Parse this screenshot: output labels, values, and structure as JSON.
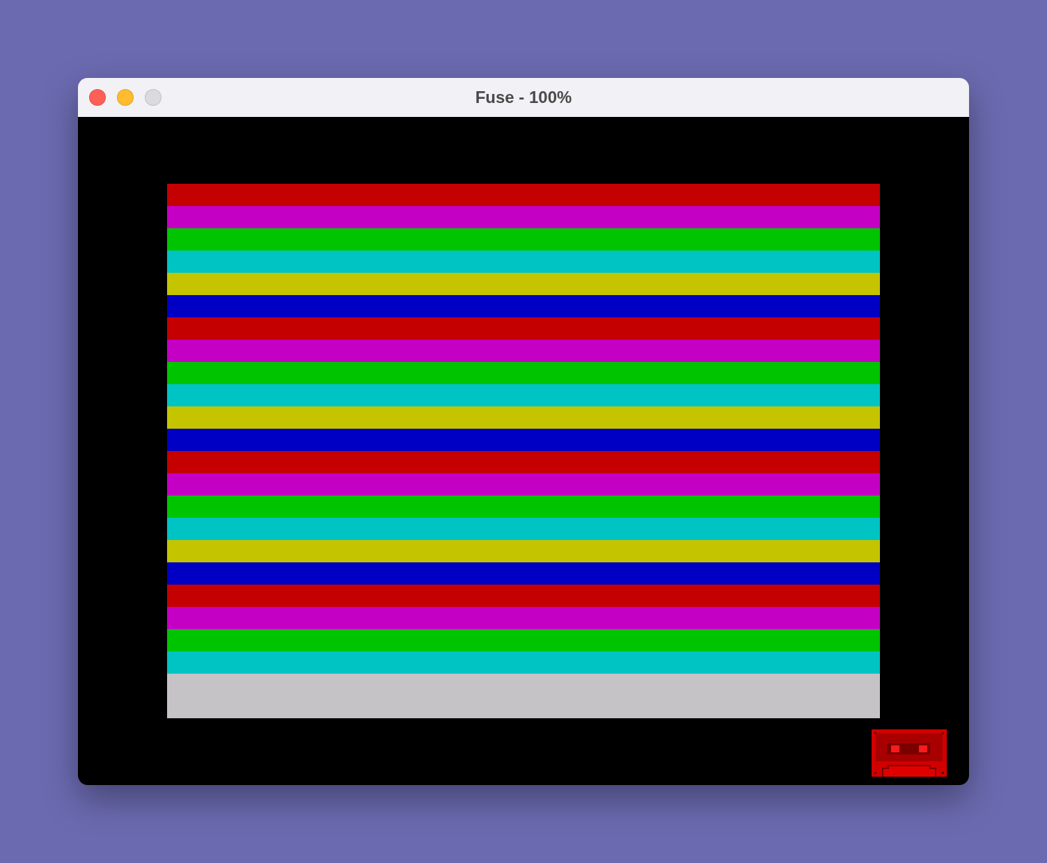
{
  "window": {
    "title": "Fuse - 100%",
    "controls": [
      {
        "kind": "close",
        "disabled": false
      },
      {
        "kind": "minimize",
        "disabled": false
      },
      {
        "kind": "zoom",
        "disabled": true
      }
    ]
  },
  "screen": {
    "stripes": [
      {
        "color": "#c40000"
      },
      {
        "color": "#c400c4"
      },
      {
        "color": "#00c400"
      },
      {
        "color": "#00c4c4"
      },
      {
        "color": "#c4c400"
      },
      {
        "color": "#0000c4"
      },
      {
        "color": "#c40000"
      },
      {
        "color": "#c400c4"
      },
      {
        "color": "#00c400"
      },
      {
        "color": "#00c4c4"
      },
      {
        "color": "#c4c400"
      },
      {
        "color": "#0000c4"
      },
      {
        "color": "#c40000"
      },
      {
        "color": "#c400c4"
      },
      {
        "color": "#00c400"
      },
      {
        "color": "#00c4c4"
      },
      {
        "color": "#c4c400"
      },
      {
        "color": "#0000c4"
      },
      {
        "color": "#c40000"
      },
      {
        "color": "#c400c4"
      },
      {
        "color": "#00c400"
      },
      {
        "color": "#00c4c4"
      }
    ]
  }
}
